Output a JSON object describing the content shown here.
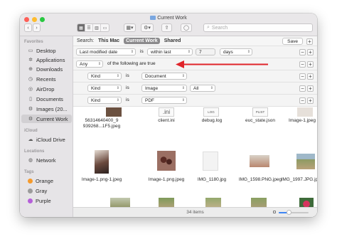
{
  "window": {
    "title": "Current Work"
  },
  "toolbar": {
    "back": "‹",
    "forward": "›",
    "search_placeholder": "Search"
  },
  "sidebar": {
    "favorites_header": "Favorites",
    "favorites": [
      {
        "label": "Desktop",
        "icon": "desktop-icon"
      },
      {
        "label": "Applications",
        "icon": "applications-icon"
      },
      {
        "label": "Downloads",
        "icon": "downloads-icon"
      },
      {
        "label": "Recents",
        "icon": "recents-icon"
      },
      {
        "label": "AirDrop",
        "icon": "airdrop-icon"
      },
      {
        "label": "Documents",
        "icon": "documents-icon"
      },
      {
        "label": "Images (20...",
        "icon": "gear-icon"
      },
      {
        "label": "Current Work",
        "icon": "gear-icon"
      }
    ],
    "icloud_header": "iCloud",
    "icloud": [
      {
        "label": "iCloud Drive",
        "icon": "cloud-icon"
      }
    ],
    "locations_header": "Locations",
    "locations": [
      {
        "label": "Network",
        "icon": "network-icon"
      }
    ],
    "tags_header": "Tags",
    "tags": [
      {
        "label": "Orange",
        "color": "#f59a2c"
      },
      {
        "label": "Gray",
        "color": "#9b9b9b"
      },
      {
        "label": "Purple",
        "color": "#b55fd9"
      }
    ]
  },
  "search": {
    "label": "Search:",
    "scope_this_mac": "This Mac",
    "scope_current": "Current Work",
    "scope_shared": "Shared",
    "save": "Save"
  },
  "criteria": [
    {
      "attr": "Last modified date",
      "op": "is",
      "cond": "within last",
      "num": "7",
      "unit": "days"
    },
    {
      "attr": "Any",
      "text": "of the following are true"
    },
    {
      "attr": "Kind",
      "op": "is",
      "cond": "Document"
    },
    {
      "attr": "Kind",
      "op": "is",
      "cond": "Image",
      "extra": "All"
    },
    {
      "attr": "Kind",
      "op": "is",
      "cond": "PDF"
    }
  ],
  "annotation": {
    "arrow_color": "#e0242a"
  },
  "files_row1": [
    "56314640400_9\n939268...1F5.jpeg",
    "client.ini",
    "debug.log",
    "euc_state.json",
    "Image-1.jpeg"
  ],
  "file_labels_row1": [
    ".ini",
    "LOG",
    "PLIST"
  ],
  "files_row2": [
    "Image-1.png-1.jpeg",
    "Image-1.png.jpeg",
    "IMG_1180.jpg",
    "IMG_1598.PNG.jpeg",
    "IMG_1997.JPG.jpeg"
  ],
  "status": {
    "item_count": "34 items"
  },
  "zoom_level": 0.35
}
